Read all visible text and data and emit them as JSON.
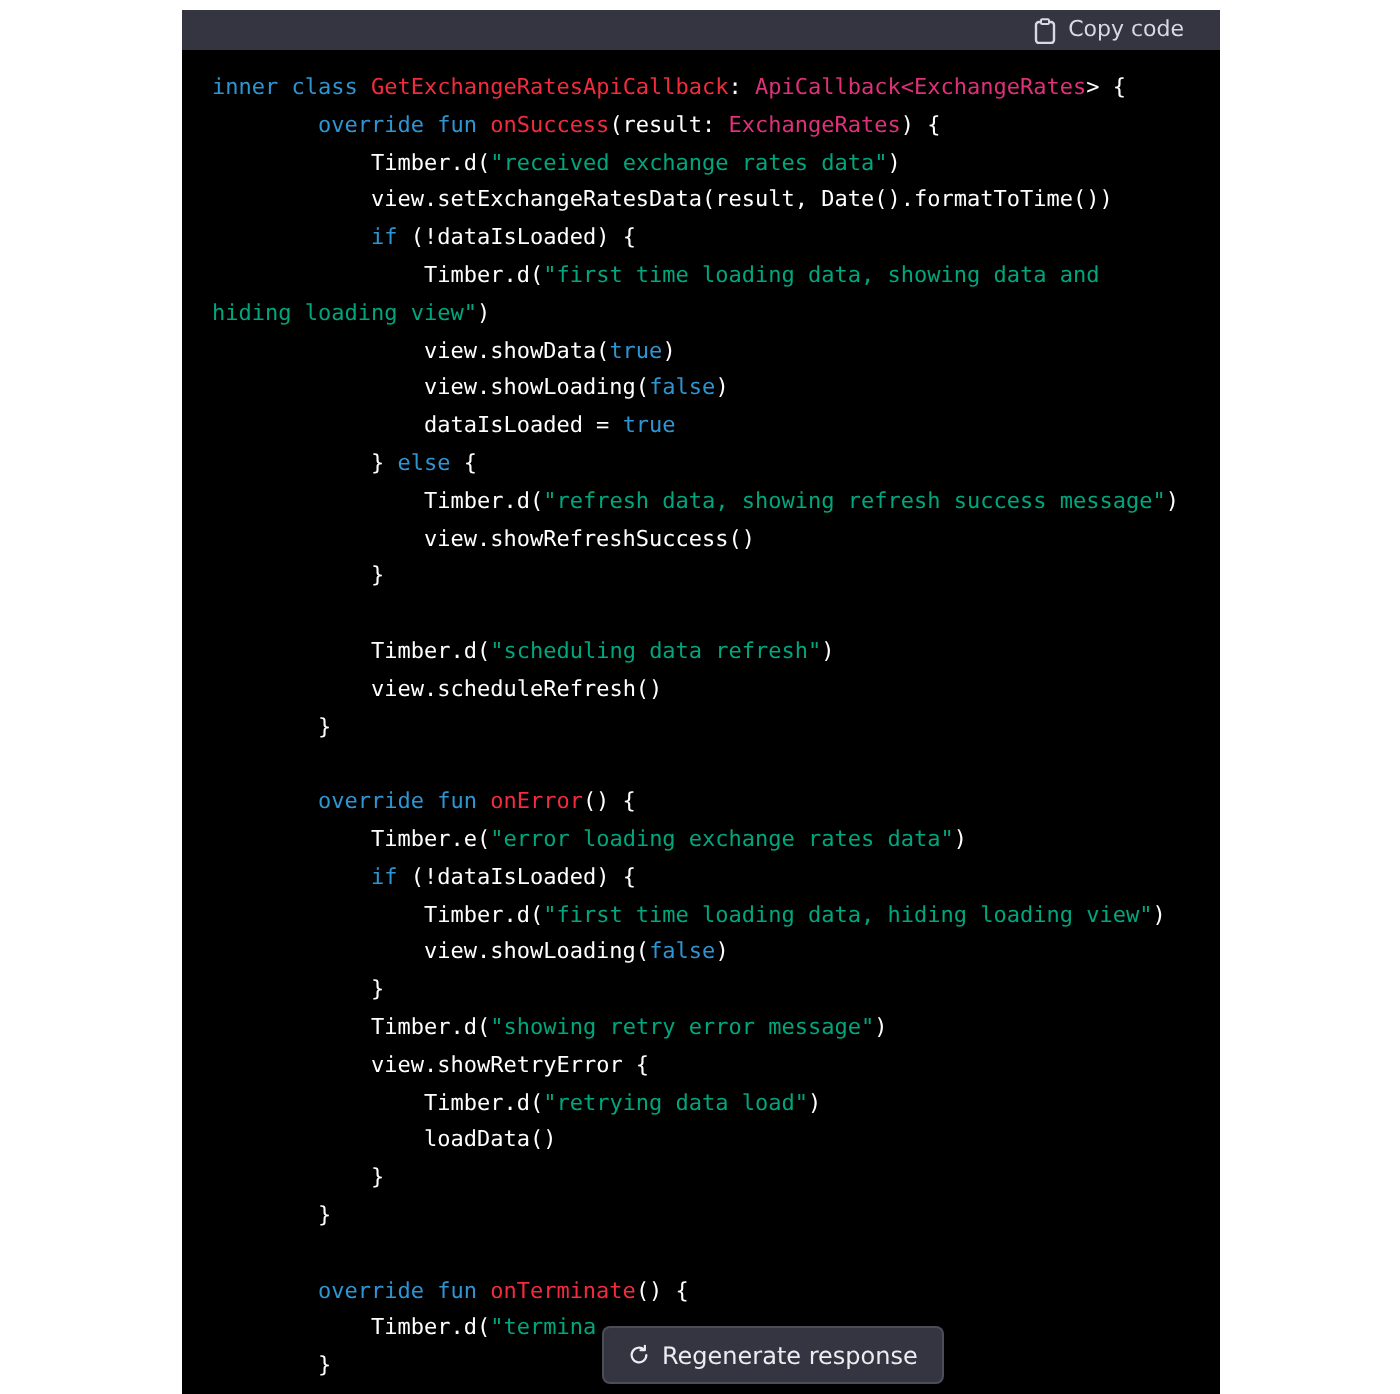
{
  "copy_button": {
    "label": "Copy code"
  },
  "code_lines": [
    {
      "kind": "code",
      "tokens": [
        {
          "kind": "keyword",
          "text": "inner class "
        },
        {
          "kind": "title",
          "text": "GetExchangeRatesApiCallback"
        },
        {
          "kind": "plain",
          "text": ": "
        },
        {
          "kind": "type",
          "text": "ApiCallback<ExchangeRates"
        },
        {
          "kind": "plain",
          "text": "> {"
        }
      ]
    },
    {
      "kind": "code",
      "tokens": [
        {
          "kind": "keyword",
          "text": "        override fun "
        },
        {
          "kind": "title",
          "text": "onSuccess"
        },
        {
          "kind": "plain",
          "text": "(result: "
        },
        {
          "kind": "type",
          "text": "ExchangeRates"
        },
        {
          "kind": "plain",
          "text": ") {"
        }
      ]
    },
    {
      "kind": "code",
      "tokens": [
        {
          "kind": "plain",
          "text": "            Timber.d("
        },
        {
          "kind": "string",
          "text": "\"received exchange rates data\""
        },
        {
          "kind": "plain",
          "text": ")"
        }
      ]
    },
    {
      "kind": "code",
      "tokens": [
        {
          "kind": "plain",
          "text": "            view.setExchangeRatesData(result, Date().formatToTime())"
        }
      ]
    },
    {
      "kind": "code",
      "tokens": [
        {
          "kind": "keyword",
          "text": "            if"
        },
        {
          "kind": "plain",
          "text": " (!dataIsLoaded) {"
        }
      ]
    },
    {
      "kind": "code",
      "tokens": [
        {
          "kind": "plain",
          "text": "                Timber.d("
        },
        {
          "kind": "string",
          "text": "\"first time loading data, showing data and hiding loading view\""
        },
        {
          "kind": "plain",
          "text": ")"
        }
      ]
    },
    {
      "kind": "code",
      "tokens": [
        {
          "kind": "plain",
          "text": "                view.showData("
        },
        {
          "kind": "keyword",
          "text": "true"
        },
        {
          "kind": "plain",
          "text": ")"
        }
      ]
    },
    {
      "kind": "code",
      "tokens": [
        {
          "kind": "plain",
          "text": "                view.showLoading("
        },
        {
          "kind": "keyword",
          "text": "false"
        },
        {
          "kind": "plain",
          "text": ")"
        }
      ]
    },
    {
      "kind": "code",
      "tokens": [
        {
          "kind": "plain",
          "text": "                dataIsLoaded = "
        },
        {
          "kind": "keyword",
          "text": "true"
        }
      ]
    },
    {
      "kind": "code",
      "tokens": [
        {
          "kind": "plain",
          "text": "            } "
        },
        {
          "kind": "keyword",
          "text": "else"
        },
        {
          "kind": "plain",
          "text": " {"
        }
      ]
    },
    {
      "kind": "code",
      "tokens": [
        {
          "kind": "plain",
          "text": "                Timber.d("
        },
        {
          "kind": "string",
          "text": "\"refresh data, showing refresh success message\""
        },
        {
          "kind": "plain",
          "text": ")"
        }
      ]
    },
    {
      "kind": "code",
      "tokens": [
        {
          "kind": "plain",
          "text": "                view.showRefreshSuccess()"
        }
      ]
    },
    {
      "kind": "code",
      "tokens": [
        {
          "kind": "plain",
          "text": "            }"
        }
      ]
    },
    {
      "kind": "blank"
    },
    {
      "kind": "code",
      "tokens": [
        {
          "kind": "plain",
          "text": "            Timber.d("
        },
        {
          "kind": "string",
          "text": "\"scheduling data refresh\""
        },
        {
          "kind": "plain",
          "text": ")"
        }
      ]
    },
    {
      "kind": "code",
      "tokens": [
        {
          "kind": "plain",
          "text": "            view.scheduleRefresh()"
        }
      ]
    },
    {
      "kind": "code",
      "tokens": [
        {
          "kind": "plain",
          "text": "        }"
        }
      ]
    },
    {
      "kind": "blank"
    },
    {
      "kind": "code",
      "tokens": [
        {
          "kind": "keyword",
          "text": "        override fun "
        },
        {
          "kind": "title",
          "text": "onError"
        },
        {
          "kind": "plain",
          "text": "() {"
        }
      ]
    },
    {
      "kind": "code",
      "tokens": [
        {
          "kind": "plain",
          "text": "            Timber.e("
        },
        {
          "kind": "string",
          "text": "\"error loading exchange rates data\""
        },
        {
          "kind": "plain",
          "text": ")"
        }
      ]
    },
    {
      "kind": "code",
      "tokens": [
        {
          "kind": "keyword",
          "text": "            if"
        },
        {
          "kind": "plain",
          "text": " (!dataIsLoaded) {"
        }
      ]
    },
    {
      "kind": "code",
      "tokens": [
        {
          "kind": "plain",
          "text": "                Timber.d("
        },
        {
          "kind": "string",
          "text": "\"first time loading data, hiding loading view\""
        },
        {
          "kind": "plain",
          "text": ")"
        }
      ]
    },
    {
      "kind": "code",
      "tokens": [
        {
          "kind": "plain",
          "text": "                view.showLoading("
        },
        {
          "kind": "keyword",
          "text": "false"
        },
        {
          "kind": "plain",
          "text": ")"
        }
      ]
    },
    {
      "kind": "code",
      "tokens": [
        {
          "kind": "plain",
          "text": "            }"
        }
      ]
    },
    {
      "kind": "code",
      "tokens": [
        {
          "kind": "plain",
          "text": "            Timber.d("
        },
        {
          "kind": "string",
          "text": "\"showing retry error message\""
        },
        {
          "kind": "plain",
          "text": ")"
        }
      ]
    },
    {
      "kind": "code",
      "tokens": [
        {
          "kind": "plain",
          "text": "            view.showRetryError {"
        }
      ]
    },
    {
      "kind": "code",
      "tokens": [
        {
          "kind": "plain",
          "text": "                Timber.d("
        },
        {
          "kind": "string",
          "text": "\"retrying data load\""
        },
        {
          "kind": "plain",
          "text": ")"
        }
      ]
    },
    {
      "kind": "code",
      "tokens": [
        {
          "kind": "plain",
          "text": "                loadData()"
        }
      ]
    },
    {
      "kind": "code",
      "tokens": [
        {
          "kind": "plain",
          "text": "            }"
        }
      ]
    },
    {
      "kind": "code",
      "tokens": [
        {
          "kind": "plain",
          "text": "        }"
        }
      ]
    },
    {
      "kind": "blank"
    },
    {
      "kind": "code",
      "tokens": [
        {
          "kind": "keyword",
          "text": "        override fun "
        },
        {
          "kind": "title",
          "text": "onTerminate"
        },
        {
          "kind": "plain",
          "text": "() {"
        }
      ]
    },
    {
      "kind": "code",
      "tokens": [
        {
          "kind": "plain",
          "text": "            Timber.d("
        },
        {
          "kind": "string",
          "text": "\"termina"
        }
      ]
    },
    {
      "kind": "code",
      "tokens": [
        {
          "kind": "plain",
          "text": "        }"
        }
      ]
    }
  ],
  "regenerate_button": {
    "label": "Regenerate response"
  }
}
